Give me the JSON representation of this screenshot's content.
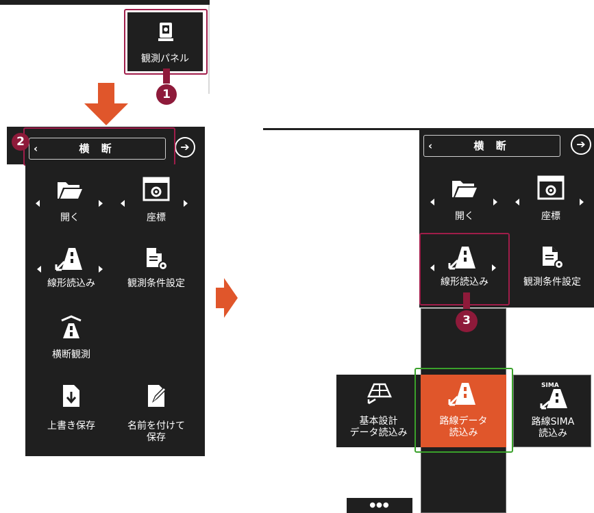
{
  "top_toolbar": {
    "observe_panel_label": "観測パネル"
  },
  "badges": {
    "b1": "1",
    "b2": "2",
    "b3": "3"
  },
  "left_panel": {
    "header_title": "横 断",
    "items": {
      "open": "開く",
      "coords": "座標",
      "alignment_import": "線形読込み",
      "observe_conditions": "観測条件設定",
      "cross_observe": "横断観測",
      "overwrite_save": "上書き保存",
      "save_as": "名前を付けて\n保存"
    }
  },
  "right_panel": {
    "header_title": "横 断",
    "items": {
      "open": "開く",
      "coords": "座標",
      "alignment_import": "線形読込み",
      "observe_conditions": "観測条件設定"
    },
    "submenu": {
      "basic_design": "基本設計\nデータ読込み",
      "route_data": "路線データ\n読込み",
      "route_sima": "路線SIMA\n読込み",
      "sima_tag": "SIMA",
      "more": "●●●"
    }
  },
  "colors": {
    "highlight": "#a01d4a",
    "accent_orange": "#e0562b",
    "green_frame": "#3aa12b"
  }
}
